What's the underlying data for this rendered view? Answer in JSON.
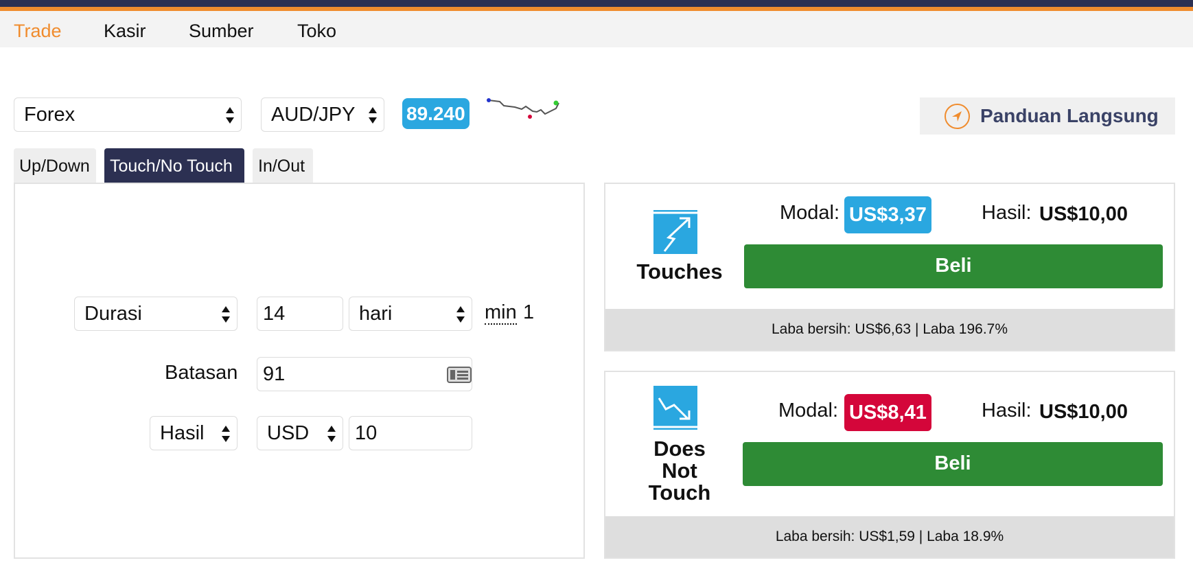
{
  "nav": {
    "items": [
      "Trade",
      "Kasir",
      "Sumber",
      "Toko"
    ],
    "active": "Trade"
  },
  "market": {
    "selected": "Forex"
  },
  "symbol": {
    "selected": "AUD/JPY"
  },
  "spot_price": "89.240",
  "guide": {
    "label": "Panduan Langsung"
  },
  "tabs": [
    {
      "label": "Up/Down",
      "active": false
    },
    {
      "label": "Touch/No Touch",
      "active": true
    },
    {
      "label": "In/Out",
      "active": false
    }
  ],
  "form": {
    "duration_type": "Durasi",
    "duration_value": "14",
    "duration_unit": "hari",
    "min_label": "min",
    "min_value": "1",
    "barrier_label": "Batasan",
    "barrier_value": "91",
    "payout_type": "Hasil",
    "currency": "USD",
    "amount": "10"
  },
  "contracts": {
    "touches": {
      "name": "Touches",
      "modal_label": "Modal:",
      "modal_value": "US$3,37",
      "hasil_label": "Hasil:",
      "hasil_value": "US$10,00",
      "buy_label": "Beli",
      "footer": "Laba bersih: US$6,63 | Laba 196.7%"
    },
    "does_not_touch": {
      "name_line1": "Does",
      "name_line2": "Not",
      "name_line3": "Touch",
      "modal_label": "Modal:",
      "modal_value": "US$8,41",
      "hasil_label": "Hasil:",
      "hasil_value": "US$10,00",
      "buy_label": "Beli",
      "footer": "Laba bersih: US$1,59 | Laba 18.9%"
    }
  },
  "colors": {
    "accent": "#f08c2e",
    "navy": "#2c3052",
    "blue": "#2aa7e0",
    "green": "#2e8b35",
    "red": "#d4063a"
  },
  "icons": [
    "compass-icon",
    "touch-arrow-up-icon",
    "no-touch-arrow-down-icon",
    "calendar-icon",
    "select-arrows-icon"
  ]
}
